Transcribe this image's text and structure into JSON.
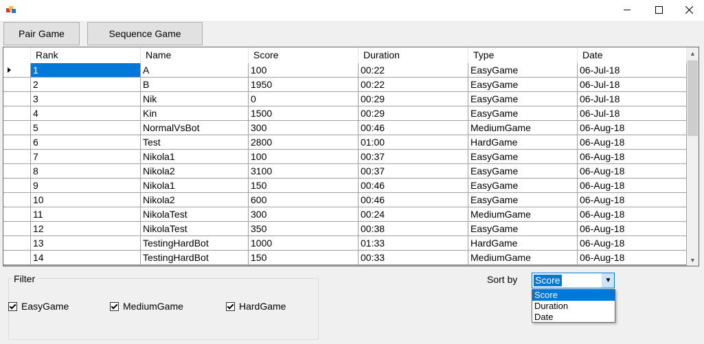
{
  "window": {
    "icon": "app-icon",
    "controls": [
      "minimize-icon",
      "maximize-icon",
      "close-icon"
    ]
  },
  "toolbar": {
    "pair_label": "Pair Game",
    "sequence_label": "Sequence Game"
  },
  "grid": {
    "columns": [
      "Rank",
      "Name",
      "Score",
      "Duration",
      "Type",
      "Date"
    ],
    "selected_row": 0,
    "rows": [
      [
        "1",
        "A",
        "100",
        "00:22",
        "EasyGame",
        "06-Jul-18"
      ],
      [
        "2",
        "B",
        "1950",
        "00:22",
        "EasyGame",
        "06-Jul-18"
      ],
      [
        "3",
        "Nik",
        "0",
        "00:29",
        "EasyGame",
        "06-Jul-18"
      ],
      [
        "4",
        "Kin",
        "1500",
        "00:29",
        "EasyGame",
        "06-Jul-18"
      ],
      [
        "5",
        "NormalVsBot",
        "300",
        "00:46",
        "MediumGame",
        "06-Aug-18"
      ],
      [
        "6",
        "Test",
        "2800",
        "01:00",
        "HardGame",
        "06-Aug-18"
      ],
      [
        "7",
        "Nikola1",
        "100",
        "00:37",
        "EasyGame",
        "06-Aug-18"
      ],
      [
        "8",
        "Nikola2",
        "3100",
        "00:37",
        "EasyGame",
        "06-Aug-18"
      ],
      [
        "9",
        "Nikola1",
        "150",
        "00:46",
        "EasyGame",
        "06-Aug-18"
      ],
      [
        "10",
        "Nikola2",
        "600",
        "00:46",
        "EasyGame",
        "06-Aug-18"
      ],
      [
        "11",
        "NikolaTest",
        "300",
        "00:24",
        "MediumGame",
        "06-Aug-18"
      ],
      [
        "12",
        "NikolaTest",
        "350",
        "00:38",
        "EasyGame",
        "06-Aug-18"
      ],
      [
        "13",
        "TestingHardBot",
        "1000",
        "01:33",
        "HardGame",
        "06-Aug-18"
      ],
      [
        "14",
        "TestingHardBot",
        "150",
        "00:33",
        "MediumGame",
        "06-Aug-18"
      ]
    ]
  },
  "filter": {
    "title": "Filter",
    "easy_label": "EasyGame",
    "medium_label": "MediumGame",
    "hard_label": "HardGame",
    "easy_checked": true,
    "medium_checked": true,
    "hard_checked": true
  },
  "sort": {
    "label": "Sort by",
    "value": "Score",
    "options": [
      "Score",
      "Duration",
      "Date"
    ]
  },
  "colors": {
    "selection": "#0078d7",
    "grid_background": "#ababab"
  }
}
